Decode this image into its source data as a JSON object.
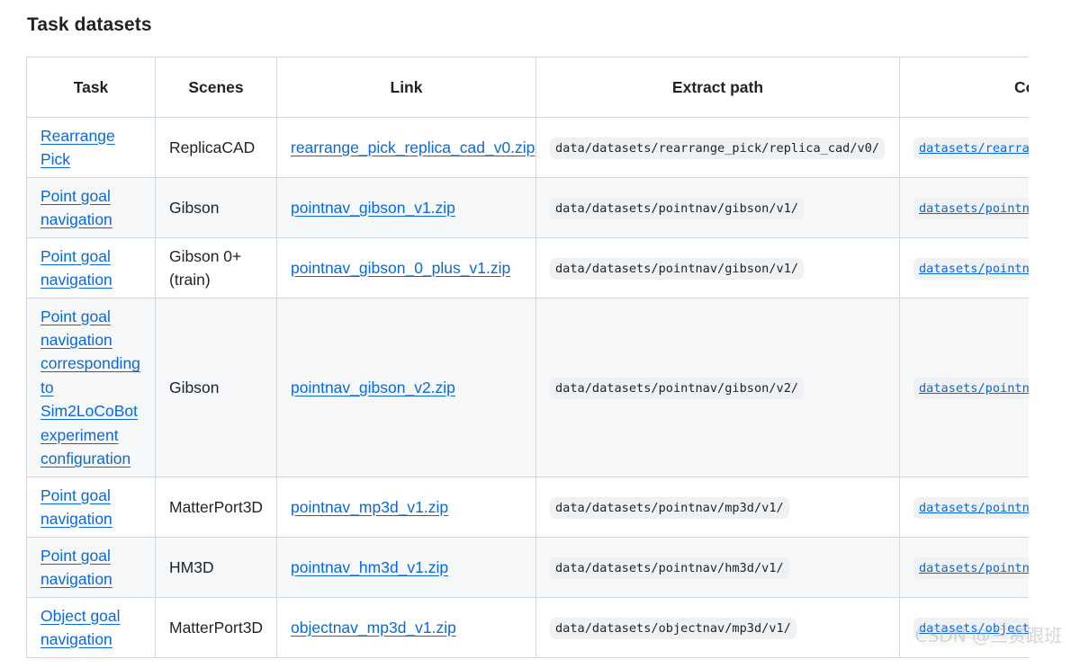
{
  "heading": "Task datasets",
  "columns": {
    "task": "Task",
    "scenes": "Scenes",
    "link": "Link",
    "extract_path": "Extract path",
    "config": "Co"
  },
  "rows": [
    {
      "task": "Rearrange Pick",
      "scenes": "ReplicaCAD",
      "link": "rearrange_pick_replica_cad_v0.zip",
      "extract_path": "data/datasets/rearrange_pick/replica_cad/v0/",
      "config": "datasets/rearra"
    },
    {
      "task": "Point goal navigation",
      "scenes": "Gibson",
      "link": "pointnav_gibson_v1.zip",
      "extract_path": "data/datasets/pointnav/gibson/v1/",
      "config": "datasets/pointn"
    },
    {
      "task": "Point goal navigation",
      "scenes": "Gibson 0+ (train)",
      "link": "pointnav_gibson_0_plus_v1.zip",
      "extract_path": "data/datasets/pointnav/gibson/v1/",
      "config": "datasets/pointn"
    },
    {
      "task": "Point goal navigation corresponding to Sim2LoCoBot experiment configuration",
      "scenes": "Gibson",
      "link": "pointnav_gibson_v2.zip",
      "extract_path": "data/datasets/pointnav/gibson/v2/",
      "config": "datasets/pointn"
    },
    {
      "task": "Point goal navigation",
      "scenes": "MatterPort3D",
      "link": "pointnav_mp3d_v1.zip",
      "extract_path": "data/datasets/pointnav/mp3d/v1/",
      "config": "datasets/pointn"
    },
    {
      "task": "Point goal navigation",
      "scenes": "HM3D",
      "link": "pointnav_hm3d_v1.zip",
      "extract_path": "data/datasets/pointnav/hm3d/v1/",
      "config": "datasets/pointn"
    },
    {
      "task": "Object goal navigation",
      "scenes": "MatterPort3D",
      "link": "objectnav_mp3d_v1.zip",
      "extract_path": "data/datasets/objectnav/mp3d/v1/",
      "config": "datasets/object"
    }
  ],
  "watermark": "CSDN @三资跟班"
}
